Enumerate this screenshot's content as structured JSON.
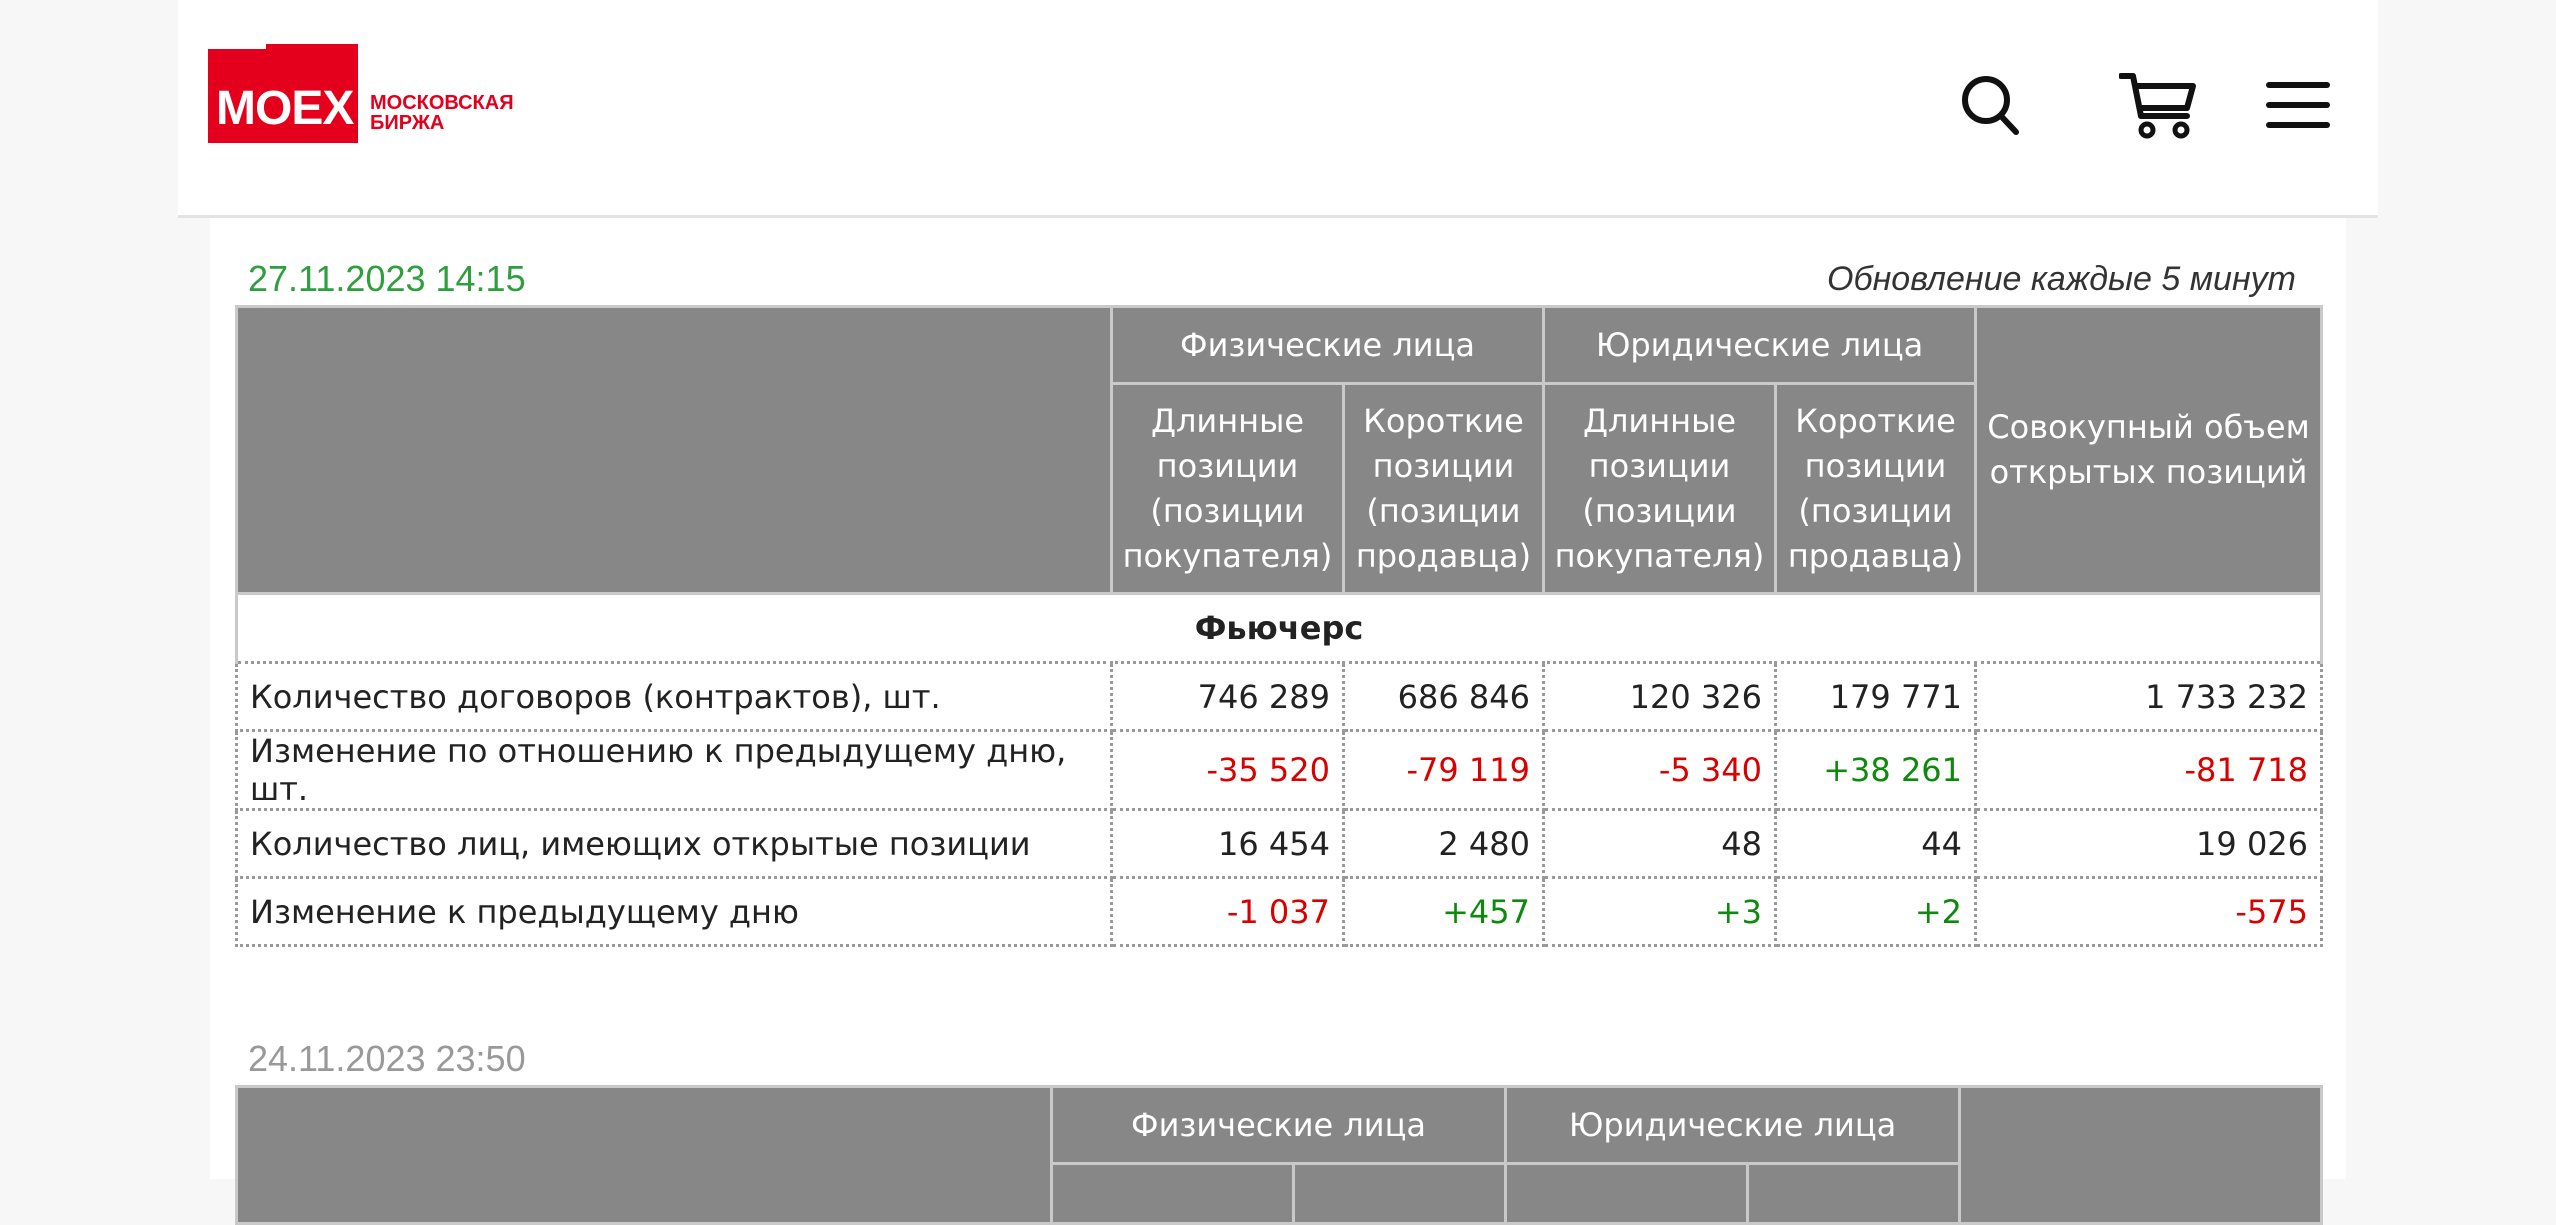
{
  "header": {
    "logo_text": "MOEX",
    "logo_sub_line1": "МОСКОВСКАЯ",
    "logo_sub_line2": "БИРЖА",
    "icons": [
      "search-icon",
      "cart-icon",
      "menu-icon"
    ]
  },
  "colors": {
    "brand_red": "#e4001c",
    "header_gray": "#878787",
    "positive": "#0d8a0d",
    "negative": "#d90000",
    "date_current": "#2f9e3f",
    "date_previous": "#999999"
  },
  "block1": {
    "date": "27.11.2023 14:15",
    "update_note": "Обновление каждые 5 минут",
    "group_phys": "Физические лица",
    "group_jur": "Юридические лица",
    "col_long": "Длинные позиции (позиции покупателя)",
    "col_short": "Короткие позиции (позиции продавца)",
    "col_total": "Совокупный объем открытых позиций",
    "section": "Фьючерс",
    "rows": [
      {
        "label": "Количество договоров (контрактов), шт.",
        "values": [
          "746 289",
          "686 846",
          "120 326",
          "179 771",
          "1 733 232"
        ],
        "signs": [
          "neu",
          "neu",
          "neu",
          "neu",
          "neu"
        ]
      },
      {
        "label": "Изменение по отношению к предыдущему дню, шт.",
        "values": [
          "-35 520",
          "-79 119",
          "-5 340",
          "+38 261",
          "-81 718"
        ],
        "signs": [
          "neg",
          "neg",
          "neg",
          "pos",
          "neg"
        ]
      },
      {
        "label": "Количество лиц, имеющих открытые позиции",
        "values": [
          "16 454",
          "2 480",
          "48",
          "44",
          "19 026"
        ],
        "signs": [
          "neu",
          "neu",
          "neu",
          "neu",
          "neu"
        ]
      },
      {
        "label": "Изменение к предыдущему дню",
        "values": [
          "-1 037",
          "+457",
          "+3",
          "+2",
          "-575"
        ],
        "signs": [
          "neg",
          "pos",
          "pos",
          "pos",
          "neg"
        ]
      }
    ]
  },
  "block2": {
    "date": "24.11.2023 23:50",
    "group_phys": "Физические лица",
    "group_jur": "Юридические лица"
  }
}
